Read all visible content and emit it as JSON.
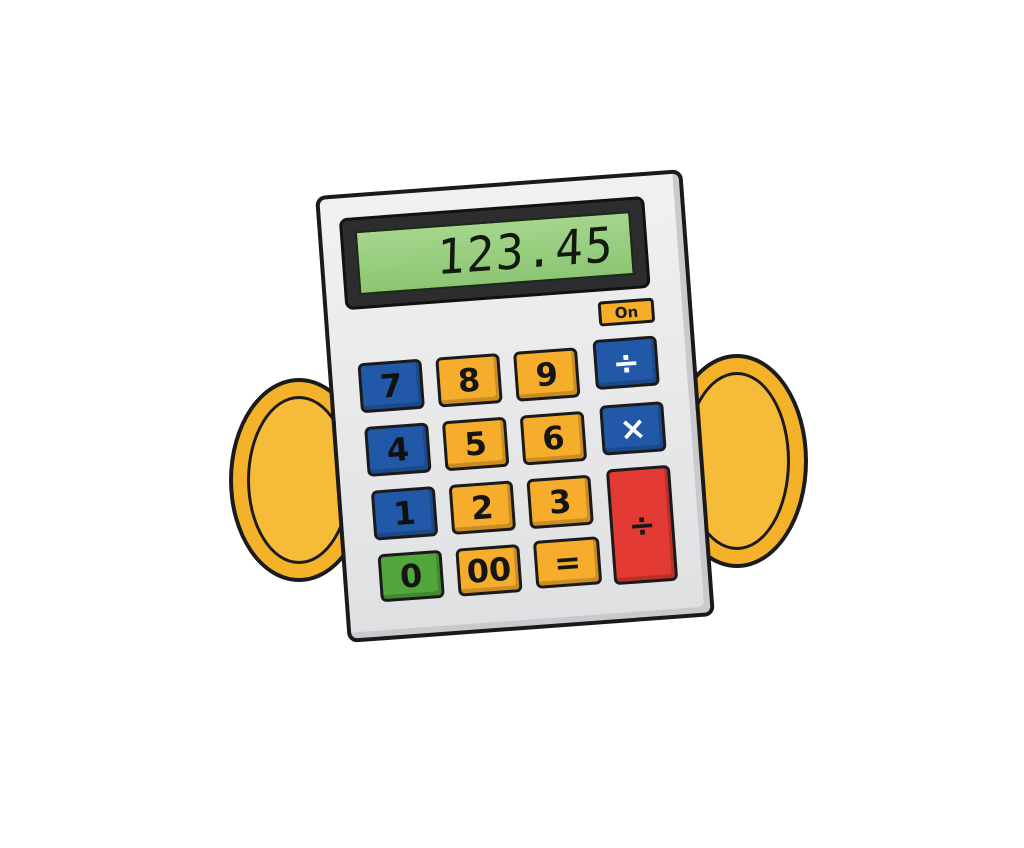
{
  "display": {
    "value": "123.45"
  },
  "power": {
    "label": "On"
  },
  "keys": {
    "seven": "7",
    "eight": "8",
    "nine": "9",
    "divide_top": "÷",
    "four": "4",
    "five": "5",
    "six": "6",
    "multiply": "×",
    "one": "1",
    "two": "2",
    "three": "3",
    "divide_tall": "÷",
    "zero": "0",
    "double_zero": "00",
    "equals": "="
  },
  "colors": {
    "number_key_blue": "#2159a8",
    "number_key_orange": "#f5ad2b",
    "zero_key_green": "#53a63b",
    "tall_key_red": "#e33a33",
    "display_green": "#98cf7f",
    "coin_gold": "#f4b22b"
  },
  "icons": {
    "coin_left": "gold-coin-icon",
    "coin_right": "gold-coin-icon"
  }
}
